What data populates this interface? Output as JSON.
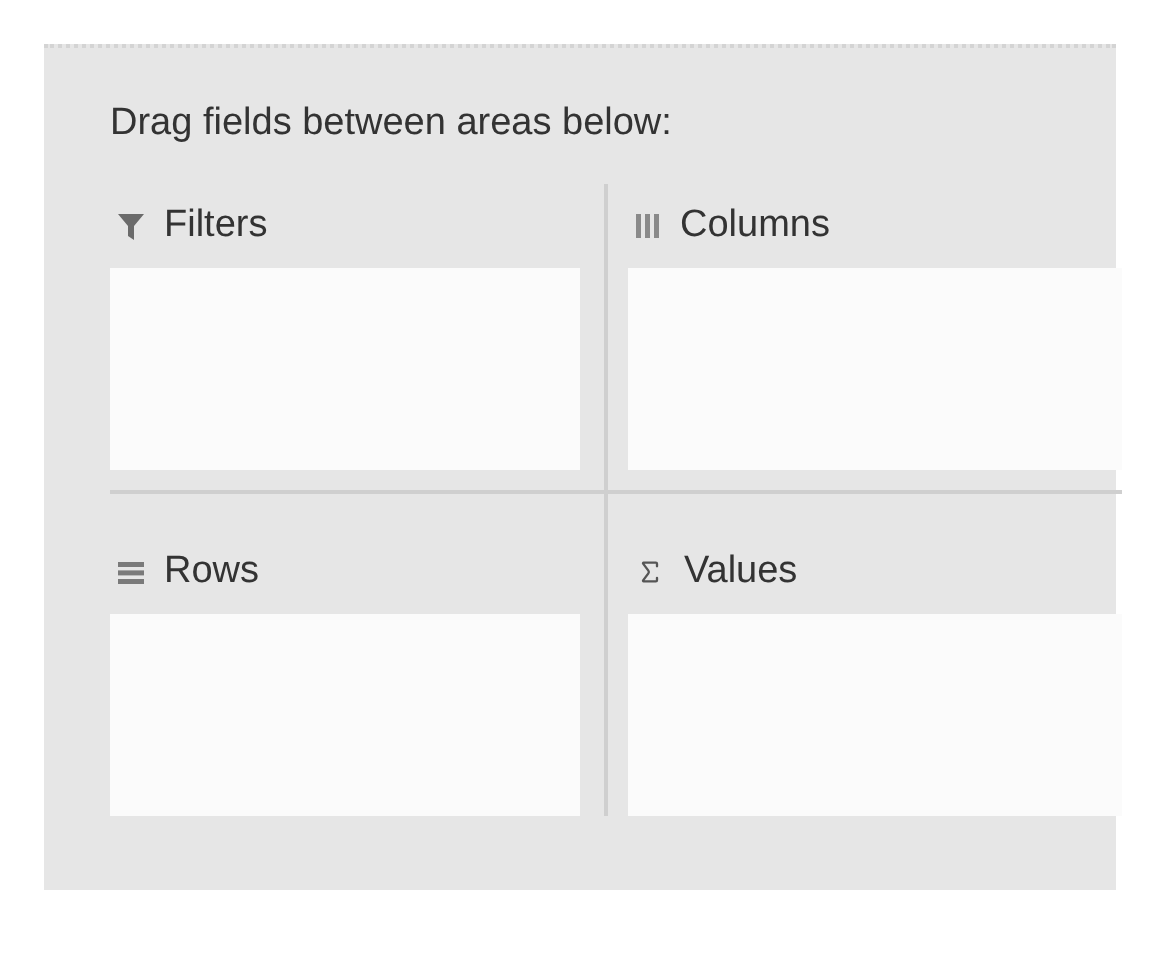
{
  "instruction": "Drag fields between areas below:",
  "areas": [
    {
      "kind": "filters",
      "label": "Filters"
    },
    {
      "kind": "columns",
      "label": "Columns"
    },
    {
      "kind": "rows",
      "label": "Rows"
    },
    {
      "kind": "values",
      "label": "Values"
    }
  ]
}
